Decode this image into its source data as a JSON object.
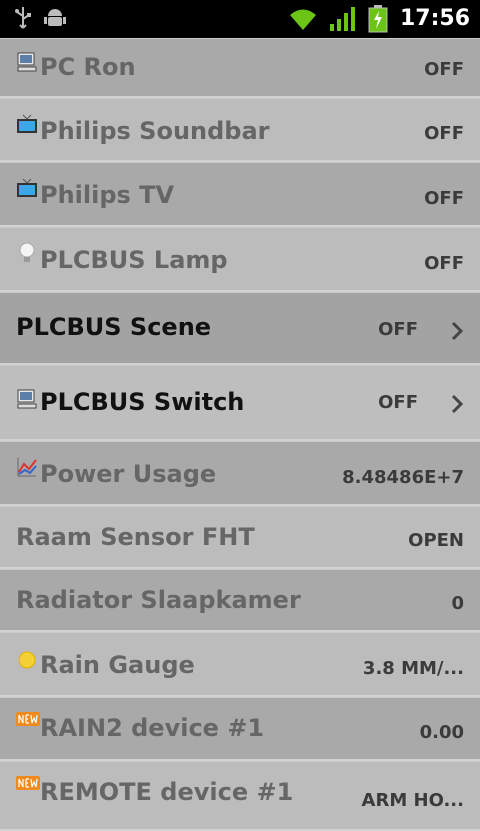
{
  "status_bar": {
    "time": "17:56",
    "icons": [
      "usb-icon",
      "android-debug-icon",
      "wifi-icon",
      "signal-icon",
      "battery-charging-icon"
    ]
  },
  "devices": [
    {
      "name": "PC Ron",
      "value": "OFF",
      "icon": "pc-icon"
    },
    {
      "name": "Philips Soundbar",
      "value": "OFF",
      "icon": "tv-icon"
    },
    {
      "name": "Philips TV",
      "value": "OFF",
      "icon": "tv-icon"
    },
    {
      "name": "PLCBUS Lamp",
      "value": "OFF",
      "icon": "lightbulb-icon"
    },
    {
      "name": "PLCBUS Scene",
      "value": "OFF",
      "icon": "",
      "active": true
    },
    {
      "name": "PLCBUS Switch",
      "value": "OFF",
      "icon": "pc-icon",
      "active": true
    },
    {
      "name": "Power Usage",
      "value": "8.48486E+7",
      "icon": "chart-icon"
    },
    {
      "name": "Raam Sensor FHT",
      "value": "OPEN",
      "icon": ""
    },
    {
      "name": "Radiator Slaapkamer",
      "value": "0",
      "icon": ""
    },
    {
      "name": "Rain Gauge",
      "value": "3.8 MM/...",
      "icon": "sun-icon"
    },
    {
      "name": "RAIN2 device #1",
      "value": "0.00",
      "icon": "new-badge-icon"
    },
    {
      "name": "REMOTE device #1",
      "value": "ARM HO...",
      "icon": "new-badge-icon"
    }
  ]
}
